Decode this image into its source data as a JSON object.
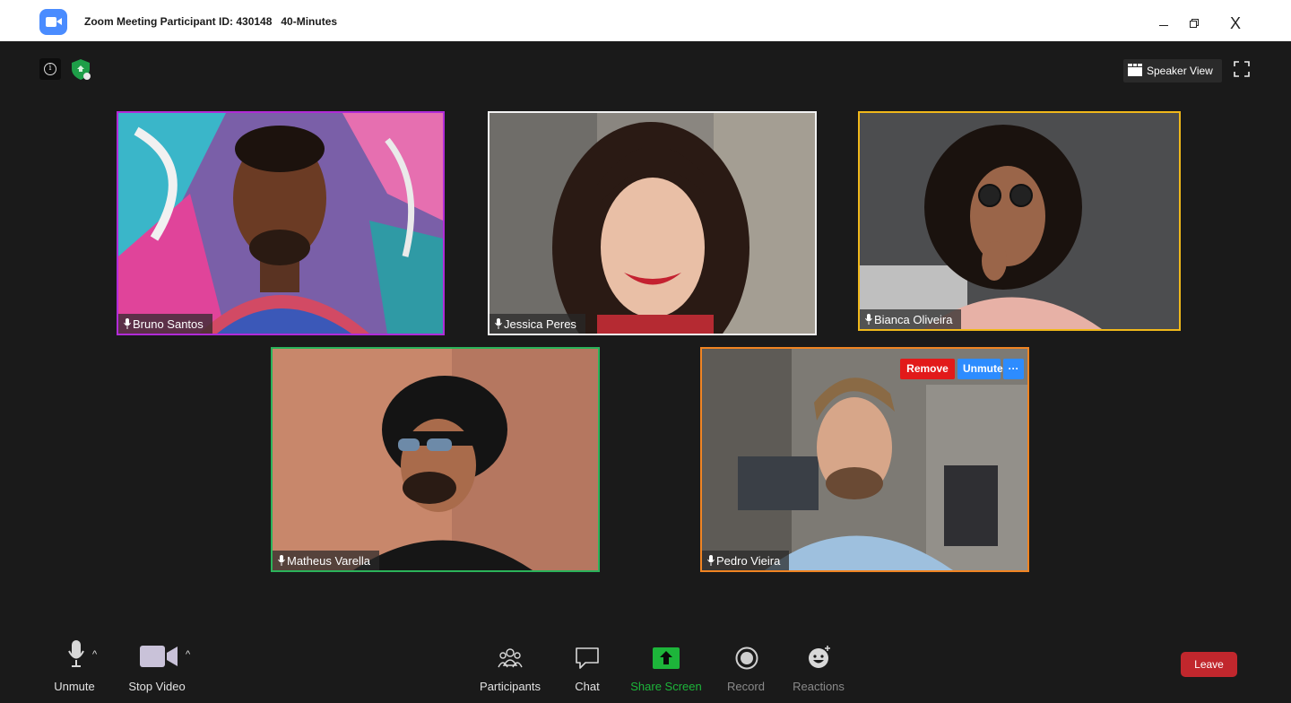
{
  "window": {
    "title": "Zoom Meeting Participant ID: 430148   40-Minutes",
    "close_label": "X"
  },
  "top_bar": {
    "speaker_view_label": "Speaker View"
  },
  "participants": [
    {
      "name": "Bruno Santos",
      "border_color": "#b12bd8"
    },
    {
      "name": "Jessica Peres",
      "border_color": "#f2f2f2"
    },
    {
      "name": "Bianca Oliveira",
      "border_color": "#f0b81a"
    },
    {
      "name": "Matheus Varella",
      "border_color": "#2bb35a"
    },
    {
      "name": "Pedro Vieira",
      "border_color": "#f08422"
    }
  ],
  "tile_actions": {
    "remove_label": "Remove",
    "unmute_label": "Unmute",
    "more_label": "···"
  },
  "toolbar": {
    "unmute_label": "Unmute",
    "stop_video_label": "Stop Video",
    "participants_label": "Participants",
    "chat_label": "Chat",
    "share_screen_label": "Share Screen",
    "record_label": "Record",
    "reactions_label": "Reactions",
    "leave_label": "Leave",
    "caret": "^"
  },
  "colors": {
    "background": "#1a1a1a",
    "accent_blue": "#2d8cff",
    "share_green": "#1db53a",
    "leave_red": "#c1272d",
    "remove_red": "#e21a1a"
  }
}
